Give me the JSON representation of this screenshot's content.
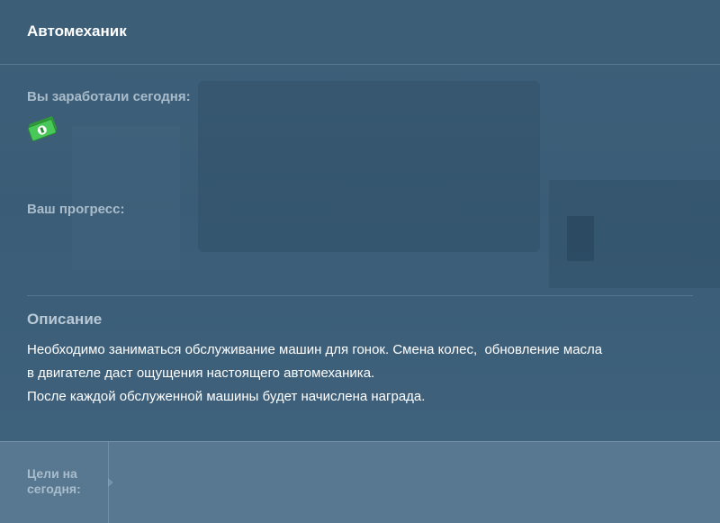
{
  "header": {
    "title": "Автомеханик"
  },
  "earnings": {
    "label": "Вы заработали сегодня:",
    "icon": "money-icon"
  },
  "progress": {
    "label": "Ваш прогресс:"
  },
  "description": {
    "heading": "Описание",
    "lines": [
      "Необходимо заниматься обслуживание машин для гонок. Смена колес,  обновление масла",
      "в двигателе даст ощущения настоящего автомеханика.",
      "После каждой обслуженной машины будет начислена награда."
    ]
  },
  "footer": {
    "goals_label": "Цели на сегодня:"
  },
  "colors": {
    "background": "#3f5f78",
    "footer": "#587891",
    "money_green": "#3fbf4a"
  }
}
